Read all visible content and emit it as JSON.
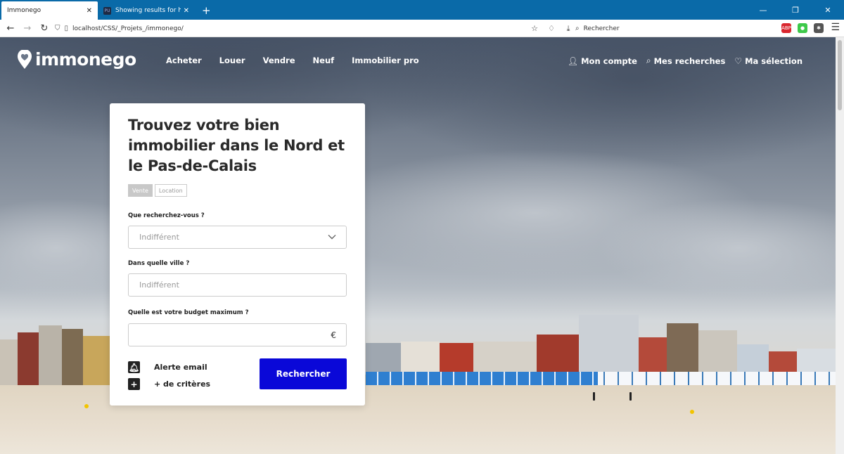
{
  "browser": {
    "tabs": [
      {
        "title": "Immonego",
        "active": true
      },
      {
        "title": "Showing results for http://www",
        "active": false
      }
    ],
    "url": "localhost/CSS/_Projets_/immonego/",
    "search_placeholder": "Rechercher"
  },
  "site": {
    "logo_text": "immonego",
    "nav": [
      "Acheter",
      "Louer",
      "Vendre",
      "Neuf",
      "Immobilier pro"
    ],
    "account": {
      "account_label": "Mon compte",
      "searches_label": "Mes recherches",
      "selection_label": "Ma sélection"
    }
  },
  "search_card": {
    "title": "Trouvez votre bien immobilier dans le Nord et le Pas-de-Calais",
    "mode_options": [
      "Vente",
      "Location"
    ],
    "selected_mode": "Vente",
    "type_label": "Que recherchez-vous ?",
    "type_value": "Indifférent",
    "city_label": "Dans quelle ville ?",
    "city_placeholder": "Indifférent",
    "budget_label": "Quelle est votre budget maximum ?",
    "budget_currency": "€",
    "alert_label": "Alerte email",
    "more_criteria_label": "+ de critères",
    "submit_label": "Rechercher"
  },
  "colors": {
    "browser_bar": "#0a6aa8",
    "primary_button": "#0a08d8"
  }
}
